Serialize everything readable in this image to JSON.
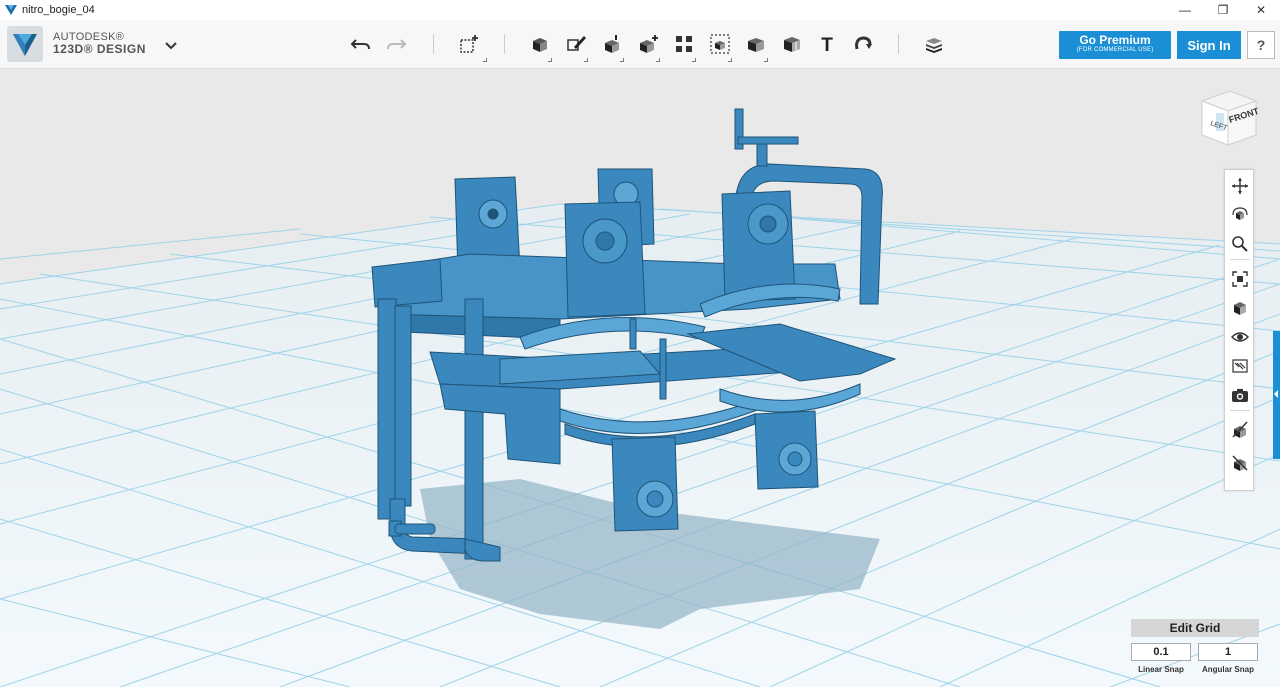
{
  "window": {
    "title": "nitro_bogie_04",
    "minimize": "—",
    "maximize": "❐",
    "close": "✕"
  },
  "brand": {
    "line1": "AUTODESK®",
    "line2": "123D® DESIGN"
  },
  "toolbar": {
    "tools": [
      {
        "name": "undo-icon"
      },
      {
        "name": "redo-icon"
      },
      {
        "name": "transform-icon"
      },
      {
        "name": "primitives-icon"
      },
      {
        "name": "sketch-icon"
      },
      {
        "name": "construct-icon"
      },
      {
        "name": "modify-icon"
      },
      {
        "name": "pattern-icon"
      },
      {
        "name": "grouping-icon"
      },
      {
        "name": "combine-icon"
      },
      {
        "name": "measure-icon"
      },
      {
        "name": "text-icon"
      },
      {
        "name": "snap-icon"
      },
      {
        "name": "material-icon"
      }
    ],
    "text_tool_glyph": "T"
  },
  "premium": {
    "label": "Go Premium",
    "sublabel": "(FOR COMMERCIAL USE)"
  },
  "signin": {
    "label": "Sign In"
  },
  "help": {
    "label": "?"
  },
  "viewcube": {
    "left_face": "LEFT",
    "front_face": "FRONT"
  },
  "navbar": {
    "items": [
      "pan-icon",
      "orbit-icon",
      "zoom-icon",
      "fit-icon",
      "views-icon",
      "visibility-icon",
      "materials-outline-icon",
      "camera-icon",
      "hide-icon",
      "show-icon"
    ]
  },
  "grid": {
    "edit_label": "Edit Grid",
    "linear_value": "0.1",
    "angular_value": "1",
    "linear_label": "Linear Snap",
    "angular_label": "Angular Snap"
  },
  "colors": {
    "model": "#3a88bd",
    "accent": "#1a8fd6",
    "grid_line": "#8fcbe6",
    "ground": "#eaf4f9",
    "sky": "#e9e9e9"
  }
}
